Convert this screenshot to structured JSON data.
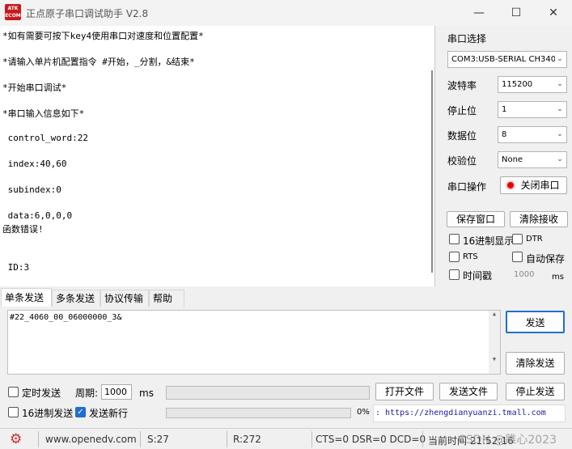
{
  "window": {
    "app_icon": "ATK ALIENTEK",
    "title": "正点原子串口调试助手 V2.8",
    "minimize": "—",
    "maximize": "☐",
    "close": "✕"
  },
  "receive": {
    "lines": [
      "*如有需要可按下key4使用串口对速度和位置配置*",
      "*请输入单片机配置指令 #开始，_分割，&结束*",
      "*开始串口调试*",
      "*串口输入信息如下*",
      " control_word:22",
      " index:40,60",
      " subindex:0",
      " data:6,0,0,0",
      "函数错误!",
      " ID:3"
    ]
  },
  "settings": {
    "port_label": "串口选择",
    "port_value": "COM3:USB-SERIAL CH340",
    "baud_label": "波特率",
    "baud_value": "115200",
    "stop_label": "停止位",
    "stop_value": "1",
    "data_label": "数据位",
    "data_value": "8",
    "parity_label": "校验位",
    "parity_value": "None",
    "op_label": "串口操作",
    "close_port": "关闭串口",
    "save_window": "保存窗口",
    "clear_receive": "清除接收",
    "hex_display": "16进制显示",
    "dtr": "DTR",
    "rts": "RTS",
    "auto_save": "自动保存",
    "timestamp": "时间戳",
    "timestamp_ms_value": "1000",
    "timestamp_unit": "ms"
  },
  "tabs": [
    "单条发送",
    "多条发送",
    "协议传输",
    "帮助"
  ],
  "send": {
    "text": "#22_4060_00_06000000_3&",
    "send_button": "发送",
    "clear_send_button": "清除发送"
  },
  "controls": {
    "timed_send": "定时发送",
    "period_label": "周期:",
    "period_value": "1000",
    "period_unit": "ms",
    "open_file": "打开文件",
    "send_file": "发送文件",
    "stop_send": "停止发送",
    "hex_send": "16进制发送",
    "send_newline": "发送新行",
    "progress_text": "0%",
    "progress": 0,
    "url": ": https://zhengdianyuanzi.tmall.com"
  },
  "status": {
    "gear_icon": "gear-icon",
    "website": "www.openedv.com",
    "s": "S:27",
    "r": "R:272",
    "lines": "CTS=0 DSR=0 DCD=0",
    "time": "当前时间 21:52:16",
    "watermark": "CSDN @雎心2023"
  },
  "colors": {
    "accent": "#1f6fd1",
    "record_dot": "#e60000",
    "url": "#1a1aa6"
  }
}
